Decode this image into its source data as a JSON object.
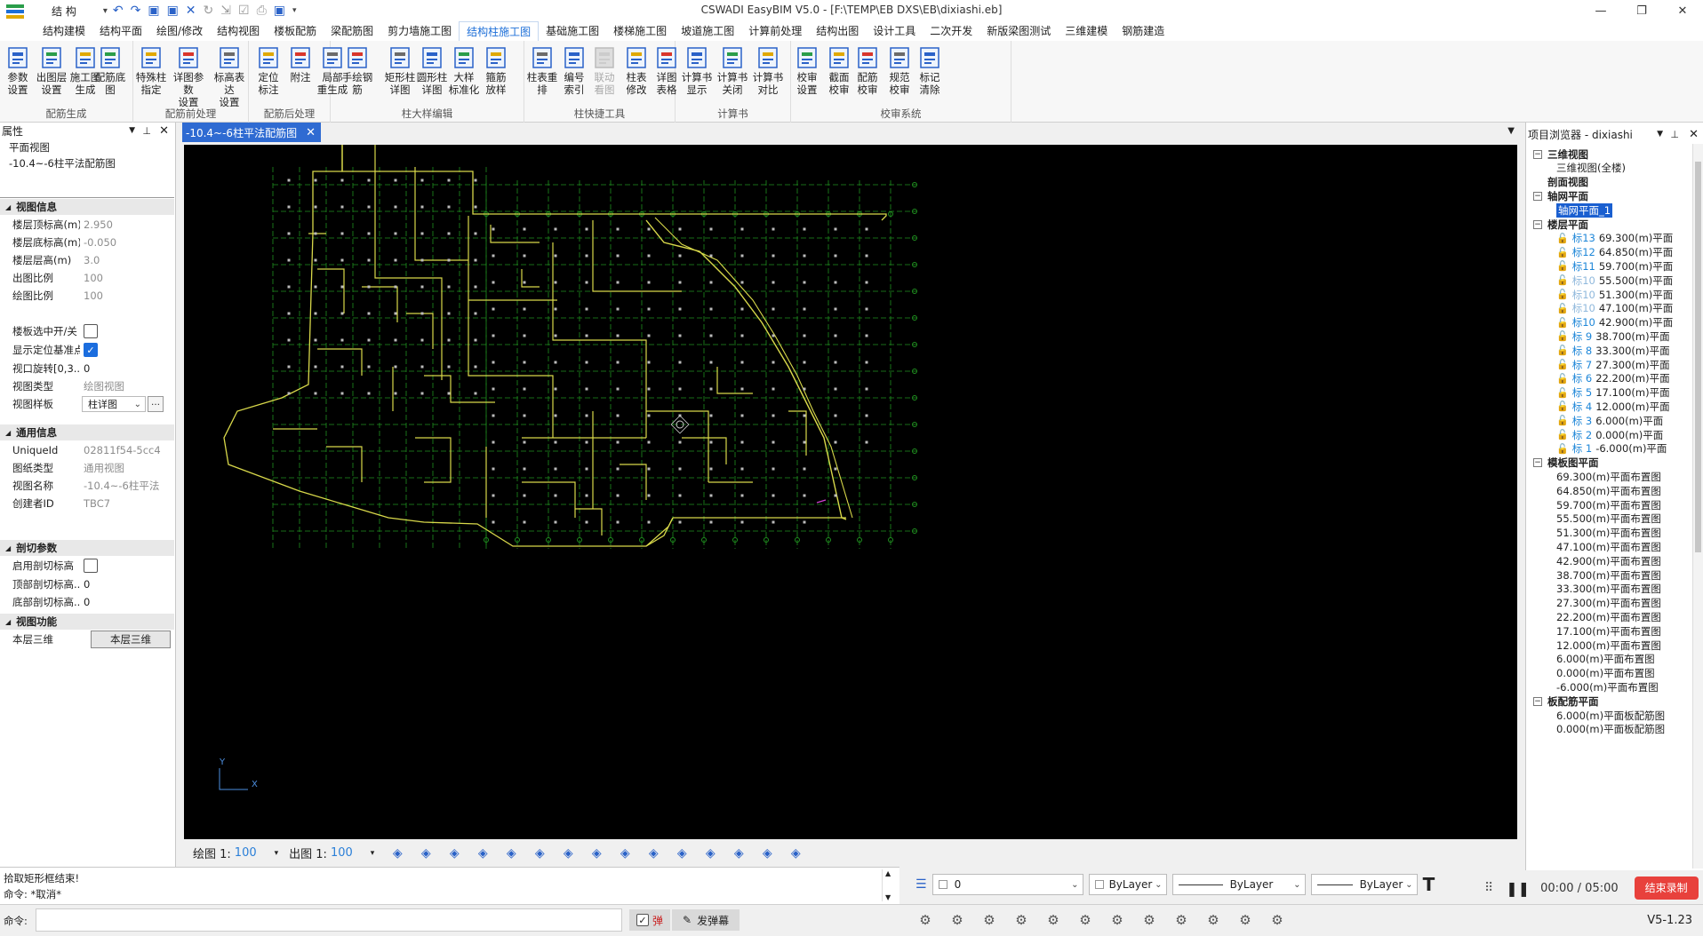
{
  "app": {
    "title": "CSWADI EasyBIM V5.0 - [F:\\TEMP\\EB DXS\\EB\\dixiashi.eb]",
    "structure_label": "结  构",
    "version": "V5-1.23"
  },
  "menu": [
    "结构建模",
    "结构平面",
    "绘图/修改",
    "结构视图",
    "楼板配筋",
    "梁配筋图",
    "剪力墙施工图",
    "结构柱施工图",
    "基础施工图",
    "楼梯施工图",
    "坡道施工图",
    "计算前处理",
    "结构出图",
    "设计工具",
    "二次开发",
    "新版梁图测试",
    "三维建模",
    "钢筋建造"
  ],
  "menu_active_index": 7,
  "ribbon_groups": [
    {
      "label": "配筋生成",
      "buttons": [
        {
          "label": "参数\n设置",
          "icon": "settings-icon"
        },
        {
          "label": "出图层\n设置",
          "icon": "layers-icon"
        },
        {
          "label": "施工图\n生成",
          "icon": "drawing-icon"
        }
      ]
    },
    {
      "label": "配筋前处理",
      "buttons": [
        {
          "label": "配筋底图",
          "icon": "column-icon"
        },
        {
          "label": "特殊柱\n指定",
          "icon": "special-column-icon"
        },
        {
          "label": "详图参数\n设置",
          "icon": "detail-settings-icon"
        },
        {
          "label": "标高表达\n设置",
          "icon": "elevation-settings-icon"
        }
      ]
    },
    {
      "label": "配筋后处理",
      "buttons": [
        {
          "label": "定位\n标注",
          "icon": "locate-icon"
        },
        {
          "label": "附注",
          "icon": "text-icon"
        },
        {
          "label": "局部\n重生成",
          "icon": "regenerate-icon"
        }
      ]
    },
    {
      "label": "柱大样编辑",
      "buttons": [
        {
          "label": "手绘钢筋",
          "icon": "hand-rebar-icon"
        },
        {
          "label": "矩形柱\n详图",
          "icon": "rect-column-icon"
        },
        {
          "label": "圆形柱\n详图",
          "icon": "round-column-icon"
        },
        {
          "label": "大样\n标准化",
          "icon": "standardize-icon"
        },
        {
          "label": "箍筋\n放样",
          "icon": "stirrup-icon"
        }
      ]
    },
    {
      "label": "柱快捷工具",
      "buttons": [
        {
          "label": "柱表重排",
          "icon": "table-sort-icon"
        },
        {
          "label": "编号\n索引",
          "icon": "index-icon"
        },
        {
          "label": "联动\n看图",
          "icon": "link-view-icon",
          "disabled": true
        },
        {
          "label": "柱表\n修改",
          "icon": "table-edit-icon"
        },
        {
          "label": "详图\n表格",
          "icon": "table-icon"
        }
      ]
    },
    {
      "label": "计算书",
      "buttons": [
        {
          "label": "计算书\n显示",
          "icon": "report-show-icon"
        },
        {
          "label": "计算书\n关闭",
          "icon": "report-close-icon"
        },
        {
          "label": "计算书\n对比",
          "icon": "report-compare-icon"
        }
      ]
    },
    {
      "label": "校审系统",
      "buttons": [
        {
          "label": "校审\n设置",
          "icon": "review-settings-icon"
        },
        {
          "label": "截面\n校审",
          "icon": "section-review-icon"
        },
        {
          "label": "配筋\n校审",
          "icon": "rebar-review-icon"
        },
        {
          "label": "规范\n校审",
          "icon": "code-review-icon"
        },
        {
          "label": "标记\n清除",
          "icon": "clear-mark-icon"
        }
      ]
    }
  ],
  "props": {
    "header": "属性",
    "view_type": "平面视图",
    "view_name": "-10.4~-6柱平法配筋图",
    "sec_view": "视图信息",
    "sec_general": "通用信息",
    "sec_cut": "剖切参数",
    "sec_func": "视图功能",
    "rows_view": [
      {
        "k": "楼层顶标高(m)",
        "v": "2.950"
      },
      {
        "k": "楼层底标高(m)",
        "v": "-0.050"
      },
      {
        "k": "楼层层高(m)",
        "v": "3.0"
      },
      {
        "k": "出图比例",
        "v": "100"
      },
      {
        "k": "绘图比例",
        "v": "100"
      }
    ],
    "chk_slab": "楼板选中开/关",
    "chk_locate": "显示定位基准点",
    "rotate_k": "视口旋转[0,3...",
    "rotate_v": "0",
    "viewtype_k": "视图类型",
    "viewtype_v": "绘图视图",
    "template_k": "视图样板",
    "template_v": "柱详图",
    "rows_general": [
      {
        "k": "UniqueId",
        "v": "02811f54-5cc4"
      },
      {
        "k": "图纸类型",
        "v": "通用视图"
      },
      {
        "k": "视图名称",
        "v": "-10.4~-6柱平法"
      },
      {
        "k": "创建者ID",
        "v": "TBC7"
      }
    ],
    "cut_enable": "启用剖切标高",
    "cut_top_k": "顶部剖切标高...",
    "cut_top_v": "0",
    "cut_bottom_k": "底部剖切标高...",
    "cut_bottom_v": "0",
    "func_k": "本层三维",
    "func_btn": "本层三维"
  },
  "doc_tab": "-10.4~-6柱平法配筋图",
  "status": {
    "draw_scale_label": "绘图 1:",
    "draw_scale": "100",
    "out_scale_label": "出图 1:",
    "out_scale": "100"
  },
  "browser": {
    "header": "项目浏览器 - dixiashi",
    "n_3d": "三维视图",
    "n_3d_all": "三维视图(全楼)",
    "n_section": "剖面视图",
    "n_grid": "轴网平面",
    "n_grid_1": "轴网平面_1",
    "n_floor": "楼层平面",
    "floors": [
      {
        "lv": "标13",
        "v": "69.300(m)平面"
      },
      {
        "lv": "标12",
        "v": "64.850(m)平面"
      },
      {
        "lv": "标11",
        "v": "59.700(m)平面"
      },
      {
        "lv": "标10",
        "v": "55.500(m)平面",
        "dim": true
      },
      {
        "lv": "标10",
        "v": "51.300(m)平面",
        "dim": true
      },
      {
        "lv": "标10",
        "v": "47.100(m)平面",
        "dim": true
      },
      {
        "lv": "标10",
        "v": "42.900(m)平面"
      },
      {
        "lv": "标 9",
        "v": "38.700(m)平面"
      },
      {
        "lv": "标 8",
        "v": "33.300(m)平面"
      },
      {
        "lv": "标 7",
        "v": "27.300(m)平面"
      },
      {
        "lv": "标 6",
        "v": "22.200(m)平面"
      },
      {
        "lv": "标 5",
        "v": "17.100(m)平面"
      },
      {
        "lv": "标 4",
        "v": "12.000(m)平面"
      },
      {
        "lv": "标 3",
        "v": "6.000(m)平面"
      },
      {
        "lv": "标 2",
        "v": "0.000(m)平面"
      },
      {
        "lv": "标 1",
        "v": "-6.000(m)平面"
      }
    ],
    "n_formwork": "模板图平面",
    "formwork": [
      "69.300(m)平面布置图",
      "64.850(m)平面布置图",
      "59.700(m)平面布置图",
      "55.500(m)平面布置图",
      "51.300(m)平面布置图",
      "47.100(m)平面布置图",
      "42.900(m)平面布置图",
      "38.700(m)平面布置图",
      "33.300(m)平面布置图",
      "27.300(m)平面布置图",
      "22.200(m)平面布置图",
      "17.100(m)平面布置图",
      "12.000(m)平面布置图",
      "6.000(m)平面布置图",
      "0.000(m)平面布置图",
      "-6.000(m)平面布置图"
    ],
    "n_slabrebar": "板配筋平面",
    "slabrebar": [
      "6.000(m)平面板配筋图",
      "0.000(m)平面板配筋图"
    ]
  },
  "command": {
    "line1": "拾取矩形框结束!",
    "line2": "命令: *取消*",
    "prompt": "命令:"
  },
  "layer": {
    "layer_value": "0",
    "color_value": "ByLayer",
    "linetype_value": "ByLayer",
    "lineweight_value": "ByLayer"
  },
  "recorder": {
    "time": "00:00 / 05:00",
    "stop_label": "结束录制"
  },
  "bottom": {
    "popup_label": "弹",
    "danmaku_label": "发弹幕"
  },
  "axis": {
    "y": "Y",
    "x": "X"
  }
}
